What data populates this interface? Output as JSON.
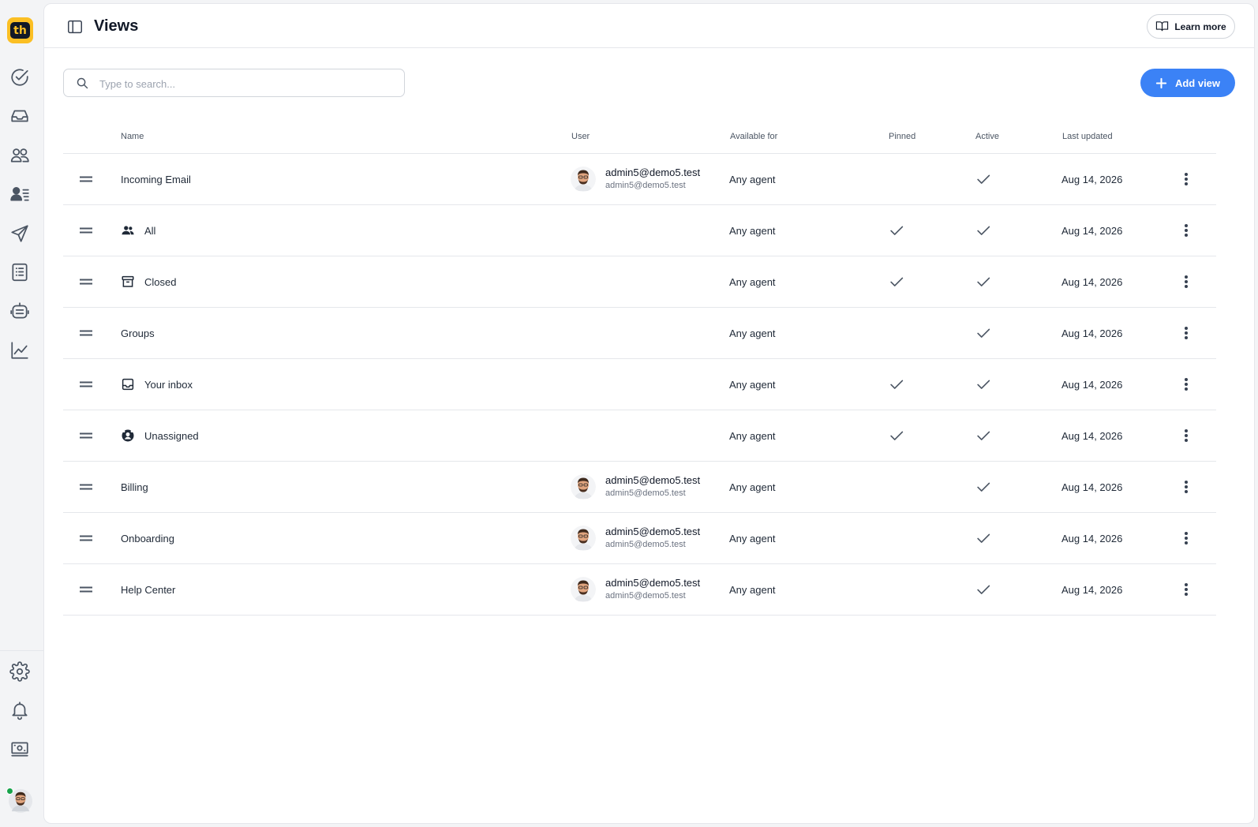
{
  "app": {
    "logo_text": "th",
    "brand_color": "#fbbf24",
    "accent_color": "#3b82f6"
  },
  "rail": {
    "top_icons": [
      "check-circle-icon",
      "inbox-icon",
      "users-icon",
      "contact-list-icon",
      "send-icon",
      "document-list-icon",
      "bot-icon",
      "analytics-icon"
    ],
    "bottom_icons": [
      "settings-icon",
      "bell-icon",
      "billing-icon",
      "profile-avatar"
    ]
  },
  "header": {
    "title": "Views",
    "learn_more": "Learn more"
  },
  "toolbar": {
    "search_placeholder": "Type to search...",
    "add_view": "Add view"
  },
  "table": {
    "columns": {
      "name": "Name",
      "user": "User",
      "available_for": "Available for",
      "pinned": "Pinned",
      "active": "Active",
      "last_updated": "Last updated"
    },
    "rows": [
      {
        "name": "Incoming Email",
        "icon": null,
        "user_name": "admin5@demo5.test",
        "user_email": "admin5@demo5.test",
        "available_for": "Any agent",
        "pinned": false,
        "active": true,
        "last_updated": "Aug 14, 2026"
      },
      {
        "name": "All",
        "icon": "group-icon",
        "user_name": null,
        "user_email": null,
        "available_for": "Any agent",
        "pinned": true,
        "active": true,
        "last_updated": "Aug 14, 2026"
      },
      {
        "name": "Closed",
        "icon": "archive-icon",
        "user_name": null,
        "user_email": null,
        "available_for": "Any agent",
        "pinned": true,
        "active": true,
        "last_updated": "Aug 14, 2026"
      },
      {
        "name": "Groups",
        "icon": null,
        "user_name": null,
        "user_email": null,
        "available_for": "Any agent",
        "pinned": false,
        "active": true,
        "last_updated": "Aug 14, 2026"
      },
      {
        "name": "Your inbox",
        "icon": "inbox-tray-icon",
        "user_name": null,
        "user_email": null,
        "available_for": "Any agent",
        "pinned": true,
        "active": true,
        "last_updated": "Aug 14, 2026"
      },
      {
        "name": "Unassigned",
        "icon": "unassigned-icon",
        "user_name": null,
        "user_email": null,
        "available_for": "Any agent",
        "pinned": true,
        "active": true,
        "last_updated": "Aug 14, 2026"
      },
      {
        "name": "Billing",
        "icon": null,
        "user_name": "admin5@demo5.test",
        "user_email": "admin5@demo5.test",
        "available_for": "Any agent",
        "pinned": false,
        "active": true,
        "last_updated": "Aug 14, 2026"
      },
      {
        "name": "Onboarding",
        "icon": null,
        "user_name": "admin5@demo5.test",
        "user_email": "admin5@demo5.test",
        "available_for": "Any agent",
        "pinned": false,
        "active": true,
        "last_updated": "Aug 14, 2026"
      },
      {
        "name": "Help Center",
        "icon": null,
        "user_name": "admin5@demo5.test",
        "user_email": "admin5@demo5.test",
        "available_for": "Any agent",
        "pinned": false,
        "active": true,
        "last_updated": "Aug 14, 2026"
      }
    ]
  }
}
